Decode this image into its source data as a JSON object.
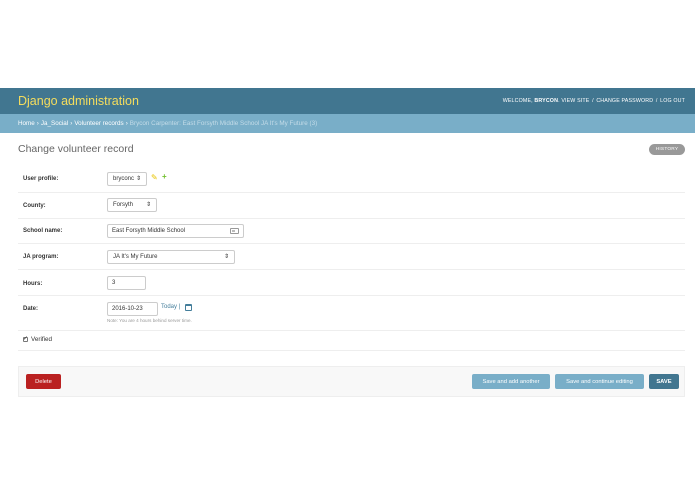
{
  "header": {
    "brand": "Django administration",
    "welcome": "WELCOME,",
    "username": "BRYCON",
    "view_site": "VIEW SITE",
    "change_password": "CHANGE PASSWORD",
    "log_out": "LOG OUT",
    "separator": "/"
  },
  "breadcrumbs": {
    "home": "Home",
    "app": "Ja_Social",
    "model": "Volunteer records",
    "current": "Brycon Carpenter: East Forsyth Middle School JA It's My Future (3)",
    "arrow": "›"
  },
  "page": {
    "title": "Change volunteer record",
    "history_label": "HISTORY"
  },
  "form": {
    "user_profile": {
      "label": "User profile:",
      "value": "bryconc"
    },
    "county": {
      "label": "County:",
      "value": "Forsyth"
    },
    "school_name": {
      "label": "School name:",
      "value": "East Forsyth Middle School"
    },
    "ja_program": {
      "label": "JA program:",
      "value": "JA It's My Future"
    },
    "hours": {
      "label": "Hours:",
      "value": "3"
    },
    "date": {
      "label": "Date:",
      "value": "2016-10-23",
      "today_link": "Today",
      "separator": "|",
      "help": "Note: You are 4 hours behind server time."
    },
    "verified": {
      "label": "Verified",
      "checked": true
    }
  },
  "actions": {
    "delete": "Delete",
    "save_add_another": "Save and add another",
    "save_continue": "Save and continue editing",
    "save": "SAVE"
  },
  "colors": {
    "header_bg": "#417690",
    "brand": "#f5dd5d",
    "breadcrumb_bg": "#79aec8",
    "delete": "#ba2121",
    "save": "#417690"
  },
  "icons": {
    "select_caret": "updown-caret-icon",
    "edit": "pencil-icon",
    "add": "plus-icon",
    "autofill": "contact-card-icon",
    "calendar": "calendar-icon"
  }
}
